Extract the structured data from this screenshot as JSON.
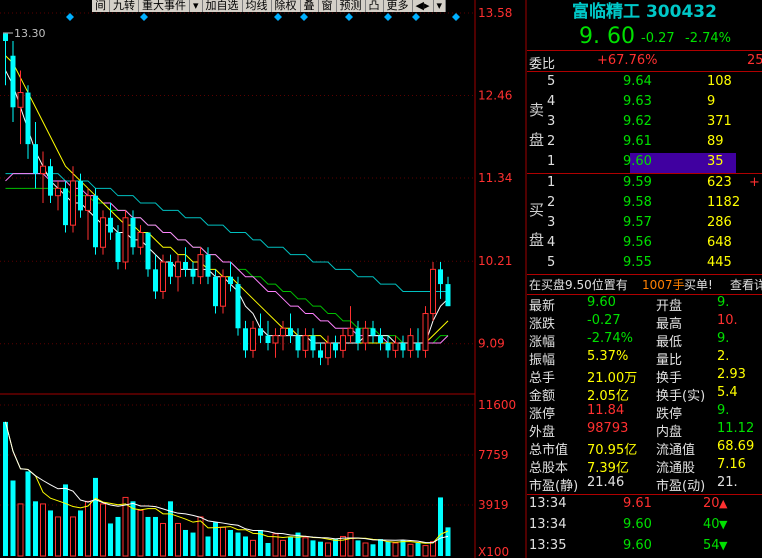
{
  "toolbar": [
    "间",
    "九转",
    "重大事件",
    "▾",
    "加自选",
    "均线",
    "除权",
    "叠",
    "窗",
    "预测",
    "凸",
    "更多",
    "◀▸",
    "▾"
  ],
  "price_axis": [
    "13.58",
    "12.46",
    "11.34",
    "10.21",
    "9.09"
  ],
  "vol_axis": [
    "11600",
    "7759",
    "3919",
    "X100"
  ],
  "high_marker": "13.30",
  "colors": {
    "up": "#ff3030",
    "down": "#00ffff",
    "ma5": "#ffffff",
    "ma10": "#ffff00",
    "ma20": "#ff80ff",
    "ma60": "#00c000",
    "ma120": "#00c0c0"
  },
  "chart_data": {
    "type": "candlestick",
    "price_range": [
      8.53,
      13.58
    ],
    "volume_range": [
      0,
      11600
    ],
    "candles": [
      [
        13.3,
        13.3,
        12.6,
        13.2
      ],
      [
        13.0,
        13.2,
        12.1,
        12.3
      ],
      [
        12.3,
        12.8,
        11.8,
        12.5
      ],
      [
        12.5,
        12.6,
        11.6,
        11.8
      ],
      [
        11.8,
        12.1,
        11.2,
        11.4
      ],
      [
        11.4,
        11.7,
        11.0,
        11.5
      ],
      [
        11.5,
        11.6,
        11.0,
        11.1
      ],
      [
        11.1,
        11.3,
        10.9,
        11.2
      ],
      [
        11.2,
        11.3,
        10.6,
        10.7
      ],
      [
        10.7,
        11.5,
        10.6,
        11.3
      ],
      [
        11.3,
        11.4,
        10.8,
        10.9
      ],
      [
        10.9,
        11.2,
        10.5,
        11.1
      ],
      [
        11.1,
        11.2,
        10.3,
        10.4
      ],
      [
        10.4,
        10.9,
        10.3,
        10.8
      ],
      [
        10.8,
        11.0,
        10.5,
        10.6
      ],
      [
        10.6,
        10.7,
        10.1,
        10.2
      ],
      [
        10.2,
        10.9,
        10.1,
        10.8
      ],
      [
        10.8,
        10.9,
        10.3,
        10.4
      ],
      [
        10.4,
        10.7,
        10.3,
        10.6
      ],
      [
        10.6,
        10.6,
        10.0,
        10.1
      ],
      [
        10.1,
        10.3,
        9.7,
        9.8
      ],
      [
        9.8,
        10.3,
        9.7,
        10.2
      ],
      [
        10.2,
        10.3,
        9.9,
        10.0
      ],
      [
        10.0,
        10.3,
        9.8,
        10.2
      ],
      [
        10.2,
        10.4,
        10.0,
        10.1
      ],
      [
        10.1,
        10.2,
        9.9,
        10.0
      ],
      [
        10.0,
        10.4,
        9.9,
        10.3
      ],
      [
        10.3,
        10.4,
        9.9,
        10.0
      ],
      [
        10.0,
        10.1,
        9.5,
        9.6
      ],
      [
        9.6,
        10.1,
        9.5,
        10.0
      ],
      [
        10.0,
        10.2,
        9.8,
        9.9
      ],
      [
        9.9,
        10.0,
        9.2,
        9.3
      ],
      [
        9.3,
        9.4,
        8.9,
        9.0
      ],
      [
        9.0,
        9.4,
        8.9,
        9.3
      ],
      [
        9.3,
        9.5,
        9.1,
        9.2
      ],
      [
        9.2,
        9.4,
        9.0,
        9.1
      ],
      [
        9.1,
        9.3,
        8.9,
        9.2
      ],
      [
        9.2,
        9.4,
        9.0,
        9.3
      ],
      [
        9.3,
        9.5,
        9.1,
        9.2
      ],
      [
        9.2,
        9.3,
        8.9,
        9.0
      ],
      [
        9.0,
        9.3,
        8.9,
        9.2
      ],
      [
        9.2,
        9.3,
        8.9,
        9.0
      ],
      [
        9.0,
        9.1,
        8.8,
        8.9
      ],
      [
        8.9,
        9.2,
        8.8,
        9.1
      ],
      [
        9.1,
        9.2,
        8.9,
        9.0
      ],
      [
        9.0,
        9.3,
        8.9,
        9.2
      ],
      [
        9.2,
        9.6,
        9.1,
        9.3
      ],
      [
        9.3,
        9.4,
        9.0,
        9.1
      ],
      [
        9.1,
        9.4,
        9.0,
        9.3
      ],
      [
        9.3,
        9.4,
        9.1,
        9.2
      ],
      [
        9.2,
        9.3,
        9.0,
        9.1
      ],
      [
        9.1,
        9.2,
        8.9,
        9.0
      ],
      [
        9.0,
        9.2,
        8.9,
        9.1
      ],
      [
        9.1,
        9.2,
        8.9,
        9.0
      ],
      [
        9.0,
        9.3,
        8.9,
        9.2
      ],
      [
        9.1,
        9.3,
        8.9,
        9.0
      ],
      [
        9.0,
        9.6,
        8.9,
        9.5
      ],
      [
        9.5,
        10.2,
        9.4,
        10.1
      ],
      [
        10.1,
        10.2,
        9.7,
        9.9
      ],
      [
        9.9,
        10.0,
        9.6,
        9.6
      ]
    ],
    "volumes": [
      103,
      58,
      40,
      65,
      42,
      40,
      35,
      30,
      55,
      30,
      35,
      42,
      60,
      40,
      25,
      30,
      45,
      42,
      35,
      30,
      30,
      25,
      42,
      25,
      20,
      18,
      30,
      15,
      26,
      22,
      20,
      18,
      15,
      12,
      20,
      10,
      17,
      12,
      15,
      18,
      14,
      12,
      11,
      10,
      13,
      15,
      18,
      12,
      10,
      9,
      13,
      11,
      10,
      12,
      9,
      10,
      8,
      11,
      45,
      22
    ],
    "moving_averages": {
      "ma5": [
        12.8,
        12.6,
        12.3,
        12.0,
        11.7,
        11.5,
        11.3,
        11.2,
        11.1,
        11.0,
        11.0,
        10.9,
        10.8,
        10.7,
        10.7,
        10.6,
        10.6,
        10.5,
        10.5,
        10.4,
        10.3,
        10.2,
        10.2,
        10.1,
        10.1,
        10.1,
        10.1,
        10.1,
        10.0,
        10.0,
        9.9,
        9.8,
        9.6,
        9.5,
        9.3,
        9.2,
        9.2,
        9.2,
        9.2,
        9.2,
        9.2,
        9.1,
        9.1,
        9.1,
        9.1,
        9.1,
        9.1,
        9.1,
        9.2,
        9.2,
        9.2,
        9.2,
        9.1,
        9.1,
        9.1,
        9.1,
        9.1,
        9.4,
        9.6,
        9.7
      ],
      "ma10": [
        13.0,
        12.9,
        12.7,
        12.5,
        12.3,
        12.1,
        11.9,
        11.7,
        11.5,
        11.4,
        11.3,
        11.2,
        11.1,
        11.0,
        10.9,
        10.8,
        10.7,
        10.7,
        10.6,
        10.6,
        10.5,
        10.4,
        10.4,
        10.3,
        10.3,
        10.2,
        10.2,
        10.1,
        10.1,
        10.0,
        10.0,
        9.9,
        9.8,
        9.7,
        9.6,
        9.5,
        9.4,
        9.3,
        9.3,
        9.2,
        9.2,
        9.2,
        9.2,
        9.1,
        9.1,
        9.1,
        9.1,
        9.1,
        9.1,
        9.1,
        9.1,
        9.1,
        9.1,
        9.1,
        9.1,
        9.1,
        9.1,
        9.2,
        9.3,
        9.4
      ],
      "ma20": [
        11.3,
        11.4,
        11.4,
        11.4,
        11.4,
        11.4,
        11.3,
        11.3,
        11.3,
        11.2,
        11.2,
        11.1,
        11.1,
        11.0,
        11.0,
        10.9,
        10.9,
        10.8,
        10.8,
        10.7,
        10.7,
        10.6,
        10.6,
        10.5,
        10.5,
        10.4,
        10.4,
        10.3,
        10.3,
        10.2,
        10.2,
        10.1,
        10.0,
        10.0,
        9.9,
        9.8,
        9.8,
        9.7,
        9.6,
        9.6,
        9.5,
        9.5,
        9.4,
        9.4,
        9.3,
        9.3,
        9.3,
        9.2,
        9.2,
        9.2,
        9.2,
        9.1,
        9.1,
        9.1,
        9.1,
        9.1,
        9.1,
        9.1,
        9.1,
        9.2
      ],
      "ma60": [
        11.2,
        11.2,
        11.2,
        11.2,
        11.2,
        11.2,
        11.2,
        11.2,
        11.2,
        11.1,
        11.1,
        11.1,
        11.0,
        11.0,
        10.9,
        10.9,
        10.9,
        10.8,
        10.8,
        10.7,
        10.7,
        10.6,
        10.6,
        10.5,
        10.5,
        10.4,
        10.4,
        10.3,
        10.3,
        10.2,
        10.2,
        10.1,
        10.1,
        10.0,
        10.0,
        9.9,
        9.9,
        9.8,
        9.8,
        9.7,
        9.7,
        9.6,
        9.6,
        9.5,
        9.5,
        9.4,
        9.4,
        9.3,
        9.3,
        9.3,
        9.2,
        9.2,
        9.2,
        9.1,
        9.1,
        9.1,
        9.1,
        9.1,
        9.2,
        9.2
      ],
      "ma120": [
        11.4,
        11.4,
        11.4,
        11.4,
        11.4,
        11.4,
        11.4,
        11.4,
        11.3,
        11.3,
        11.3,
        11.3,
        11.2,
        11.2,
        11.2,
        11.1,
        11.1,
        11.1,
        11.0,
        11.0,
        11.0,
        10.9,
        10.9,
        10.9,
        10.8,
        10.8,
        10.8,
        10.7,
        10.7,
        10.7,
        10.6,
        10.6,
        10.6,
        10.5,
        10.5,
        10.4,
        10.4,
        10.4,
        10.3,
        10.3,
        10.3,
        10.2,
        10.2,
        10.2,
        10.1,
        10.1,
        10.1,
        10.0,
        10.0,
        10.0,
        9.9,
        9.9,
        9.9,
        9.8,
        9.8,
        9.8,
        9.8,
        9.8,
        9.8,
        9.8
      ]
    }
  },
  "panel": {
    "name": "富临精工 300432",
    "price": "9. 60",
    "change": "-0.27",
    "change_pct": "-2.74%",
    "weibi_label": "委比",
    "weibi_value": "+67.76%",
    "weibi_right": "25",
    "sell_label": [
      "卖",
      "盘"
    ],
    "buy_label": [
      "买",
      "盘"
    ],
    "asks": [
      {
        "lvl": "5",
        "price": "9.64",
        "vol": "108"
      },
      {
        "lvl": "4",
        "price": "9.63",
        "vol": "9"
      },
      {
        "lvl": "3",
        "price": "9.62",
        "vol": "371"
      },
      {
        "lvl": "2",
        "price": "9.61",
        "vol": "89"
      },
      {
        "lvl": "1",
        "price": "9.60",
        "vol": "35"
      }
    ],
    "bids": [
      {
        "lvl": "1",
        "price": "9.59",
        "vol": "623",
        "extra": "+"
      },
      {
        "lvl": "2",
        "price": "9.58",
        "vol": "1182",
        "extra": ""
      },
      {
        "lvl": "3",
        "price": "9.57",
        "vol": "286",
        "extra": ""
      },
      {
        "lvl": "4",
        "price": "9.56",
        "vol": "648",
        "extra": ""
      },
      {
        "lvl": "5",
        "price": "9.55",
        "vol": "445",
        "extra": ""
      }
    ],
    "position_text": "在买盘9.50位置有",
    "position_vol": "1007手",
    "position_action": "买单!",
    "position_link": "查看详",
    "stats": [
      {
        "l": "最新",
        "v": "9.60",
        "vc": "green",
        "r": "开盘",
        "rv": "9.",
        "rc": "green"
      },
      {
        "l": "涨跌",
        "v": "-0.27",
        "vc": "green",
        "r": "最高",
        "rv": "10.",
        "rc": "red"
      },
      {
        "l": "涨幅",
        "v": "-2.74%",
        "vc": "green",
        "r": "最低",
        "rv": "9.",
        "rc": "green"
      },
      {
        "l": "振幅",
        "v": "5.37%",
        "vc": "yellow",
        "r": "量比",
        "rv": "2.",
        "rc": "yellow"
      },
      {
        "l": "总手",
        "v": "21.00万",
        "vc": "yellow",
        "r": "换手",
        "rv": "2.93",
        "rc": "yellow"
      },
      {
        "l": "金额",
        "v": "2.05亿",
        "vc": "yellow",
        "r": "换手(实)",
        "rv": "5.4",
        "rc": "yellow"
      },
      {
        "l": "涨停",
        "v": "11.84",
        "vc": "red",
        "r": "跌停",
        "rv": "9.",
        "rc": "green"
      },
      {
        "l": "外盘",
        "v": "98793",
        "vc": "red",
        "r": "内盘",
        "rv": "11.12",
        "rc": "green"
      },
      {
        "l": "总市值",
        "v": "70.95亿",
        "vc": "yellow",
        "r": "流通值",
        "rv": "68.69",
        "rc": "yellow"
      },
      {
        "l": "总股本",
        "v": "7.39亿",
        "vc": "yellow",
        "r": "流通股",
        "rv": "7.16",
        "rc": "yellow"
      },
      {
        "l": "市盈(静)",
        "v": "21.46",
        "vc": "white",
        "r": "市盈(动)",
        "rv": "21.",
        "rc": "white"
      }
    ],
    "ticks": [
      {
        "t": "13:34",
        "p": "9.61",
        "pc": "red",
        "v": "20",
        "vc": "red",
        "dir": "up"
      },
      {
        "t": "13:34",
        "p": "9.60",
        "pc": "green",
        "v": "40",
        "vc": "green",
        "dir": "down"
      },
      {
        "t": "13:35",
        "p": "9.60",
        "pc": "green",
        "v": "54",
        "vc": "green",
        "dir": "down"
      }
    ]
  }
}
